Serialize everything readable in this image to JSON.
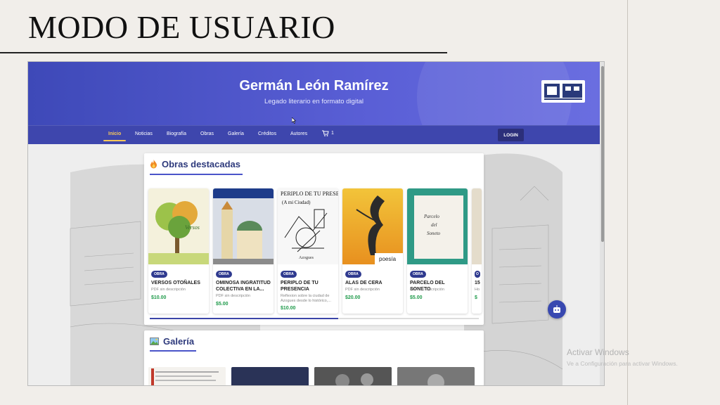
{
  "slide": {
    "title": "MODO DE USUARIO"
  },
  "site": {
    "title": "Germán León Ramírez",
    "subtitle": "Legado literario en formato digital"
  },
  "nav": {
    "items": [
      "Inicio",
      "Noticias",
      "Biografía",
      "Obras",
      "Galería",
      "Créditos",
      "Autores"
    ],
    "cart_count": "1",
    "login_label": "LOGIN"
  },
  "featured": {
    "title": "Obras destacadas",
    "books": [
      {
        "badge": "OBRA",
        "title": "VERSOS OTOÑALES",
        "desc": "PDF sin descripción",
        "price": "$10.00"
      },
      {
        "badge": "OBRA",
        "title": "OMINOSA INGRATITUD COLECTIVA EN LA...",
        "desc": "PDF sin descripción",
        "price": "$5.00"
      },
      {
        "badge": "OBRA",
        "title": "PERIPLO DE TU PRESENCIA",
        "desc": "Reflexion sobre la ciudad de Azogues desde lo histórico,...",
        "price": "$10.00"
      },
      {
        "badge": "OBRA",
        "title": "ALAS DE CERA",
        "desc": "PDF sin descripción",
        "price": "$20.00"
      },
      {
        "badge": "OBRA",
        "title": "PARCELO DEL SONETO",
        "desc": "PDF sin descripción",
        "price": "$5.00"
      },
      {
        "badge": "O",
        "title": "15",
        "desc": "Ho",
        "price": "$"
      }
    ]
  },
  "gallery": {
    "title": "Galería"
  },
  "os": {
    "watermark_title": "Activar Windows",
    "watermark_sub": "Ve a Configuración para activar Windows."
  },
  "colors": {
    "header": "#3e49b8",
    "nav": "#3e46ad",
    "accent": "#f7c85a",
    "price": "#1f9a4a",
    "title": "#2e3a7c"
  }
}
